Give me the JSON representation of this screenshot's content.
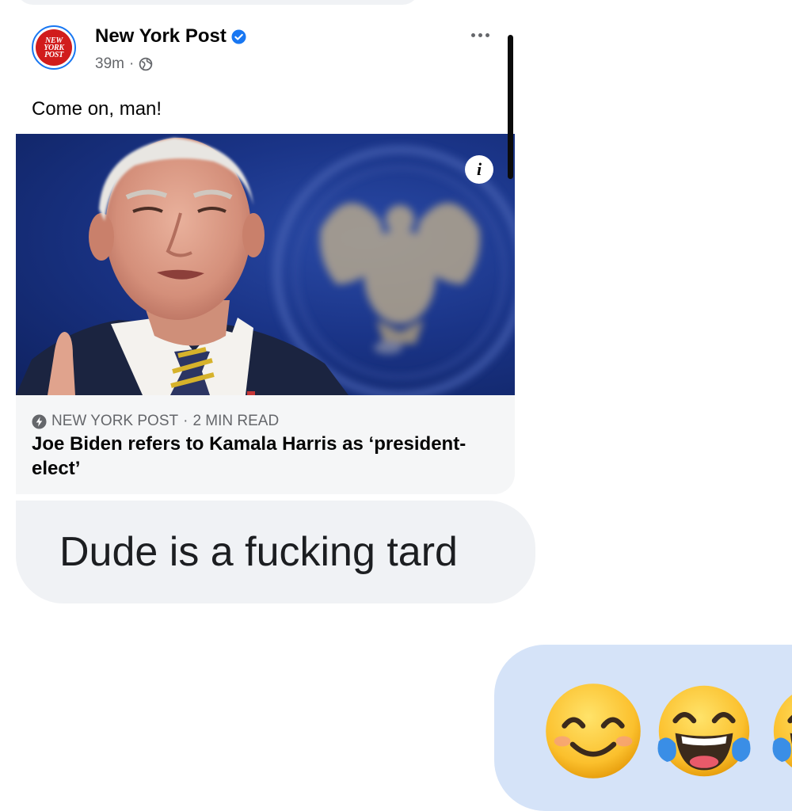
{
  "post": {
    "page_name": "New York Post",
    "avatar_text": [
      "NEW",
      "YORK",
      "POST"
    ],
    "time": "39m",
    "separator": "·",
    "caption": "Come on, man!",
    "photo_description_icon": "i",
    "source": "NEW YORK POST",
    "read_time": "2 MIN READ",
    "headline": "Joe Biden refers to Kamala Harris as ‘president-elect’"
  },
  "messages": {
    "received_text": "Dude is a fucking tard",
    "sent_emojis": [
      "smiling-face-with-smiling-eyes",
      "face-with-tears-of-joy",
      "face-with-tears-of-joy"
    ]
  },
  "colors": {
    "received_bubble": "#f0f2f5",
    "sent_bubble": "#d5e3f8",
    "verified_blue": "#1877f2",
    "brand_red": "#d11c1c"
  }
}
